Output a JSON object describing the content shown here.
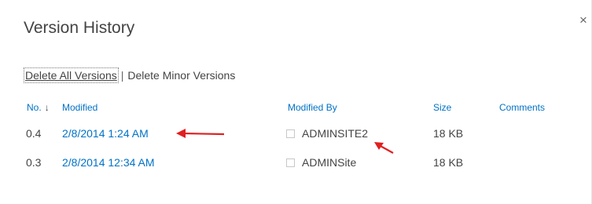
{
  "dialog": {
    "title": "Version History",
    "close_glyph": "×"
  },
  "actions": {
    "delete_all": "Delete All Versions",
    "separator": "|",
    "delete_minor": "Delete Minor Versions"
  },
  "table": {
    "columns": {
      "no": "No.",
      "no_sort_icon": "↓",
      "modified": "Modified",
      "modified_by": "Modified By",
      "size": "Size",
      "comments": "Comments"
    },
    "rows": [
      {
        "no": "0.4",
        "modified": "2/8/2014 1:24 AM",
        "modified_by": "ADMINSITE2",
        "size": "18 KB",
        "comments": ""
      },
      {
        "no": "0.3",
        "modified": "2/8/2014 12:34 AM",
        "modified_by": "ADMINSite",
        "size": "18 KB",
        "comments": ""
      }
    ]
  },
  "colors": {
    "link": "#0072c6",
    "annotation_arrow": "#e02020"
  }
}
